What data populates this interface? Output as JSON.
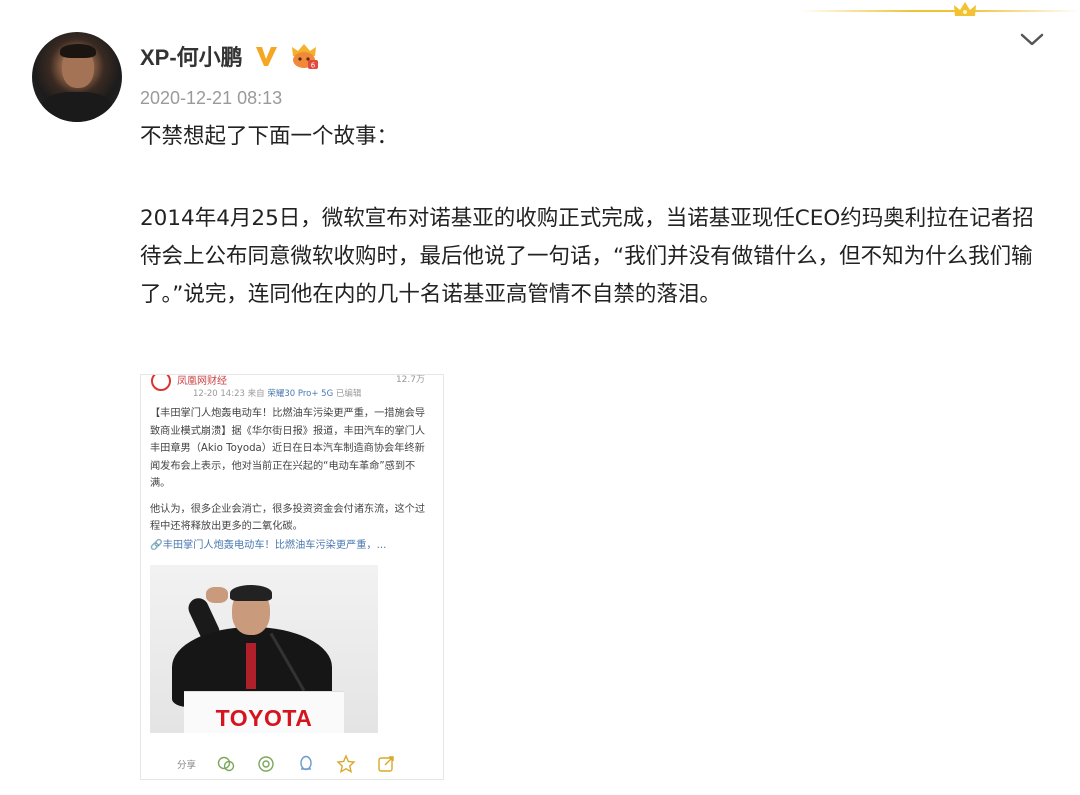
{
  "post": {
    "author": "XP-何小鹏",
    "timestamp": "2020-12-21 08:13",
    "paragraph1": "不禁想起了下面一个故事：",
    "paragraph2": "2014年4月25日，微软宣布对诺基亚的收购正式完成，当诺基亚现任CEO约玛奥利拉在记者招待会上公布同意微软收购时，最后他说了一句话，“我们并没有做错什么，但不知为什么我们输了。”说完，连同他在内的几十名诺基亚高管情不自禁的落泪。"
  },
  "embedded_image": {
    "source_name": "凤凰网财经",
    "count": "12.7万",
    "time": "12-20 14:23",
    "from_label": "来自",
    "device": "荣耀30 Pro+ 5G",
    "edited": "已编辑",
    "text1": "【丰田掌门人炮轰电动车！比燃油车污染更严重，一措施会导致商业模式崩溃】据《华尔街日报》报道，丰田汽车的掌门人丰田章男（Akio Toyoda）近日在日本汽车制造商协会年终新闻发布会上表示，他对当前正在兴起的“电动车革命”感到不满。",
    "text2": "他认为，很多企业会消亡，很多投资资金会付诸东流，这个过程中还将释放出更多的二氧化碳。",
    "link": "丰田掌门人炮轰电动车！比燃油车污染更严重，...",
    "brand": "TOYOTA",
    "share_label": "分享"
  },
  "icons": {
    "verified": "verified-v-icon",
    "member": "member-crown-badge-icon",
    "collapse": "chevron-down-icon"
  },
  "colors": {
    "verified": "#f5a623",
    "timestamp": "#9a9a9a",
    "link": "#4a78b0",
    "brand": "#d4141e"
  }
}
